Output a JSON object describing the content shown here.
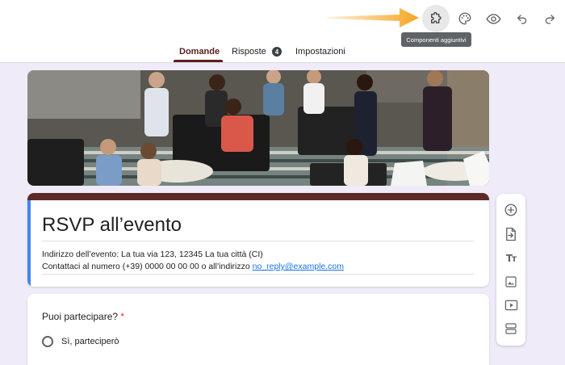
{
  "header": {
    "toolbar": {
      "addons_label": "Componenti aggiuntivi",
      "icons": [
        "puzzle-icon",
        "palette-icon",
        "eye-icon",
        "undo-icon",
        "redo-icon"
      ]
    },
    "tabs": [
      {
        "label": "Domande"
      },
      {
        "label": "Risposte",
        "badge": "4"
      },
      {
        "label": "Impostazioni"
      }
    ]
  },
  "form": {
    "title": "RSVP all’evento",
    "description_line1": "Indirizzo dell’evento: La tua via 123, 12345 La tua città (CI)",
    "description_line2_prefix": "Contattaci al numero (+39) 0000 00 00 00 o all’indirizzo ",
    "email": "no_reply@example.com"
  },
  "question": {
    "title": "Puoi partecipare?",
    "required_mark": "*",
    "options": [
      {
        "label": "Sì, parteciperò"
      }
    ]
  },
  "side_toolbar": {
    "icons": [
      "add-question-icon",
      "import-questions-icon",
      "add-title-icon",
      "add-image-icon",
      "add-video-icon",
      "add-section-icon"
    ]
  },
  "colors": {
    "accent": "#5c1f1c",
    "header_bar": "#5c2b27",
    "page_bg": "#f0ebf8",
    "arrow": "#f5a623",
    "link": "#1a73e8"
  }
}
